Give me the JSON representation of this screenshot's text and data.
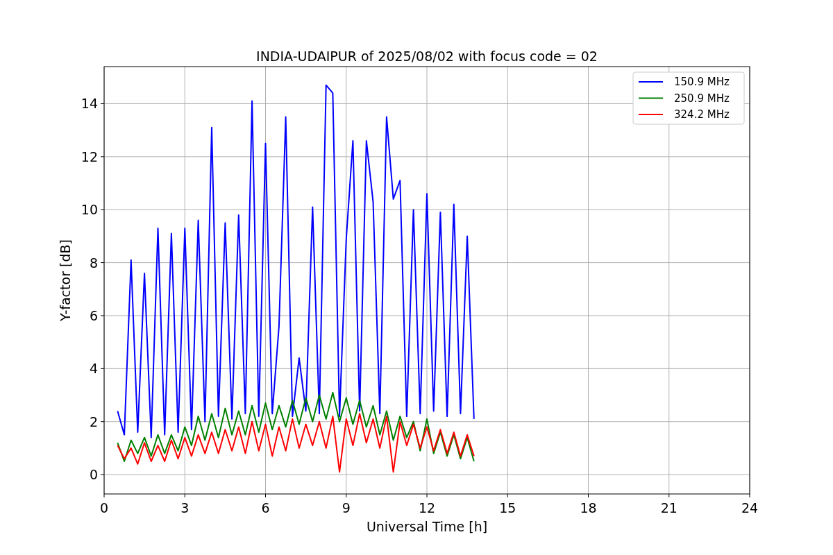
{
  "figure": {
    "chart_data": {
      "type": "line",
      "title": "INDIA-UDAIPUR of 2025/08/02 with focus code = 02",
      "xlabel": "Universal Time [h]",
      "ylabel": "Y-factor [dB]",
      "xlim": [
        0,
        24
      ],
      "ylim": [
        -0.73,
        15.4
      ],
      "grid": true,
      "legend": true,
      "xticks": [
        0,
        3,
        6,
        9,
        12,
        15,
        18,
        21,
        24
      ],
      "yticks": [
        0,
        2,
        4,
        6,
        8,
        10,
        12,
        14
      ],
      "x": [
        0.5,
        0.75,
        1.0,
        1.25,
        1.5,
        1.75,
        2.0,
        2.25,
        2.5,
        2.75,
        3.0,
        3.25,
        3.5,
        3.75,
        4.0,
        4.25,
        4.5,
        4.75,
        5.0,
        5.25,
        5.5,
        5.75,
        6.0,
        6.25,
        6.5,
        6.75,
        7.0,
        7.25,
        7.5,
        7.75,
        8.0,
        8.25,
        8.5,
        8.75,
        9.0,
        9.25,
        9.5,
        9.75,
        10.0,
        10.25,
        10.5,
        10.75,
        11.0,
        11.25,
        11.5,
        11.75,
        12.0,
        12.25,
        12.5,
        12.75,
        13.0,
        13.25,
        13.5,
        13.75
      ],
      "series": [
        {
          "name": "150.9 MHz",
          "color": "#0000ff",
          "values": [
            2.4,
            1.5,
            8.1,
            1.6,
            7.6,
            1.4,
            9.3,
            1.5,
            9.1,
            1.6,
            9.3,
            1.7,
            9.6,
            2.0,
            13.1,
            2.2,
            9.5,
            2.1,
            9.8,
            2.3,
            14.1,
            2.2,
            12.5,
            2.3,
            5.6,
            13.5,
            2.2,
            4.4,
            2.4,
            10.1,
            2.3,
            14.7,
            14.4,
            2.2,
            8.9,
            12.6,
            2.4,
            12.6,
            10.3,
            2.3,
            13.5,
            10.4,
            11.1,
            2.2,
            10.0,
            2.3,
            10.6,
            2.4,
            9.9,
            2.2,
            10.2,
            2.3,
            9.0,
            2.1
          ]
        },
        {
          "name": "250.9 MHz",
          "color": "#008000",
          "values": [
            1.2,
            0.5,
            1.3,
            0.8,
            1.4,
            0.7,
            1.5,
            0.8,
            1.5,
            0.9,
            1.8,
            1.1,
            2.2,
            1.3,
            2.3,
            1.4,
            2.5,
            1.5,
            2.4,
            1.5,
            2.6,
            1.6,
            2.7,
            1.7,
            2.6,
            1.8,
            2.8,
            1.9,
            2.9,
            2.0,
            3.0,
            2.1,
            3.1,
            2.0,
            2.9,
            1.9,
            2.8,
            1.8,
            2.6,
            1.5,
            2.4,
            1.3,
            2.2,
            1.4,
            2.0,
            0.9,
            2.1,
            0.8,
            1.6,
            0.7,
            1.5,
            0.6,
            1.4,
            0.5
          ]
        },
        {
          "name": "324.2 MHz",
          "color": "#ff0000",
          "values": [
            1.1,
            0.6,
            1.0,
            0.4,
            1.2,
            0.5,
            1.1,
            0.5,
            1.3,
            0.6,
            1.4,
            0.7,
            1.5,
            0.8,
            1.6,
            0.8,
            1.7,
            0.9,
            1.8,
            0.8,
            2.0,
            0.9,
            1.9,
            0.7,
            1.8,
            0.9,
            2.1,
            1.0,
            1.9,
            1.1,
            2.0,
            1.0,
            2.2,
            0.1,
            2.1,
            1.1,
            2.3,
            1.2,
            2.1,
            1.0,
            2.2,
            0.1,
            2.0,
            1.1,
            1.9,
            1.0,
            1.8,
            0.9,
            1.7,
            0.8,
            1.6,
            0.7,
            1.5,
            0.7
          ]
        }
      ]
    }
  }
}
